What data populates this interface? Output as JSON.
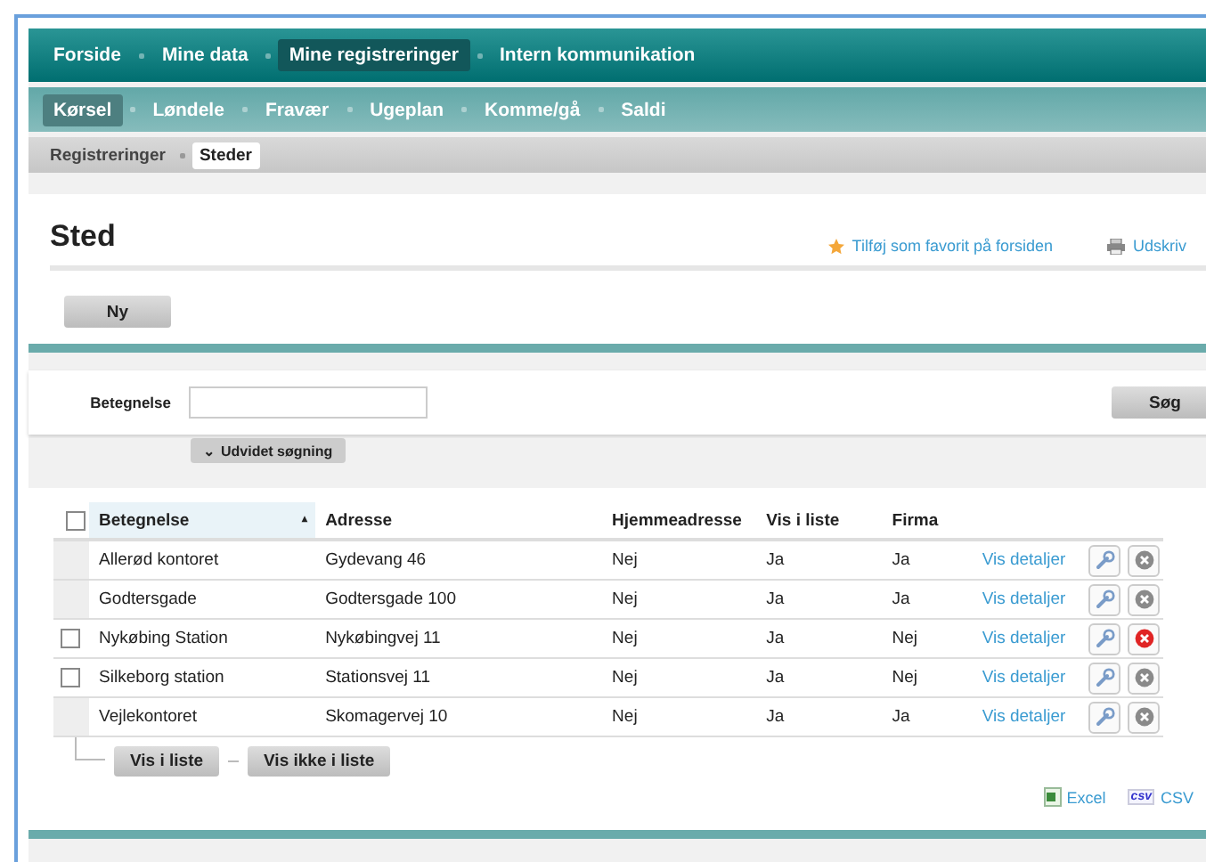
{
  "main_nav": [
    {
      "label": "Forside",
      "selected": false
    },
    {
      "label": "Mine data",
      "selected": false
    },
    {
      "label": "Mine registreringer",
      "selected": true
    },
    {
      "label": "Intern kommunikation",
      "selected": false
    }
  ],
  "sub_nav": [
    {
      "label": "Kørsel",
      "selected": true
    },
    {
      "label": "Løndele",
      "selected": false
    },
    {
      "label": "Fravær",
      "selected": false
    },
    {
      "label": "Ugeplan",
      "selected": false
    },
    {
      "label": "Komme/gå",
      "selected": false
    },
    {
      "label": "Saldi",
      "selected": false
    }
  ],
  "breadcrumb": [
    {
      "label": "Registreringer",
      "selected": false
    },
    {
      "label": "Steder",
      "selected": true
    }
  ],
  "page": {
    "title": "Sted",
    "favorite_link": "Tilføj som favorit på forsiden",
    "print_link": "Udskriv",
    "new_button": "Ny"
  },
  "search": {
    "label": "Betegnelse",
    "button": "Søg",
    "advanced_button": "Udvidet søgning",
    "advanced_caret": "⌄"
  },
  "table": {
    "header_checked": false,
    "columns": [
      {
        "label": "Betegnelse",
        "sorted": true
      },
      {
        "label": "Adresse",
        "sorted": false
      },
      {
        "label": "Hjemmeadresse",
        "sorted": false
      },
      {
        "label": "Vis i liste",
        "sorted": false
      },
      {
        "label": "Firma",
        "sorted": false
      }
    ],
    "sort_arrow": "▴",
    "rows": [
      {
        "cells": [
          "Allerød kontoret",
          "Gydevang 46",
          "Nej",
          "Ja",
          "Ja"
        ],
        "selectable": false,
        "deletable": false,
        "link": "Vis detaljer"
      },
      {
        "cells": [
          "Godtersgade",
          "Godtersgade 100",
          "Nej",
          "Ja",
          "Ja"
        ],
        "selectable": false,
        "deletable": false,
        "link": "Vis detaljer"
      },
      {
        "cells": [
          "Nykøbing Station",
          "Nykøbingvej 11",
          "Nej",
          "Ja",
          "Nej"
        ],
        "selectable": true,
        "checked": false,
        "deletable": true,
        "link": "Vis detaljer"
      },
      {
        "cells": [
          "Silkeborg station",
          "Stationsvej 11",
          "Nej",
          "Ja",
          "Nej"
        ],
        "selectable": true,
        "checked": false,
        "deletable": false,
        "link": "Vis detaljer"
      },
      {
        "cells": [
          "Vejlekontoret",
          "Skomagervej 10",
          "Nej",
          "Ja",
          "Ja"
        ],
        "selectable": false,
        "deletable": false,
        "link": "Vis detaljer"
      }
    ],
    "bulk_buttons": [
      "Vis i liste",
      "Vis ikke i liste"
    ],
    "exports": [
      {
        "kind": "excel",
        "label": "Excel"
      },
      {
        "kind": "csv",
        "label": "CSV",
        "icon_text": "csv"
      }
    ]
  }
}
